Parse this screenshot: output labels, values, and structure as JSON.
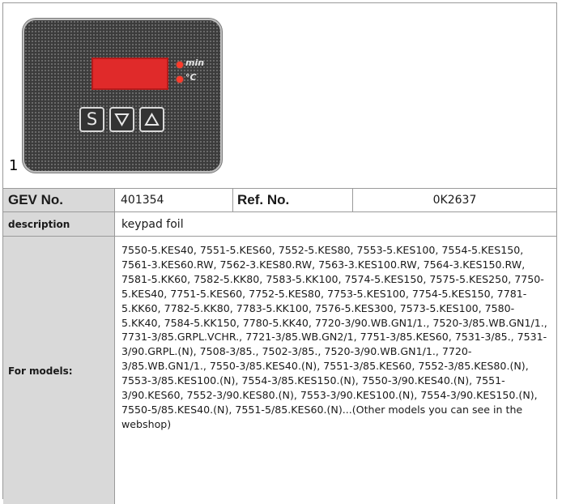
{
  "figure": {
    "number": "1",
    "led_labels": [
      "min",
      "°C"
    ],
    "buttons": [
      {
        "symbol": "S",
        "name": "set"
      },
      {
        "symbol": "▽",
        "name": "down"
      },
      {
        "symbol": "△",
        "name": "up"
      }
    ]
  },
  "product": {
    "gev_label": "GEV No.",
    "gev_value": "401354",
    "ref_label": "Ref. No.",
    "ref_value": "0K2637",
    "description_label": "description",
    "description_value": "keypad foil",
    "models_label": "For models:",
    "models_value": "7550-5.KES40, 7551-5.KES60, 7552-5.KES80, 7553-5.KES100, 7554-5.KES150, 7561-3.KES60.RW, 7562-3.KES80.RW, 7563-3.KES100.RW, 7564-3.KES150.RW, 7581-5.KK60, 7582-5.KK80, 7583-5.KK100, 7574-5.KES150, 7575-5.KES250, 7750-5.KES40, 7751-5.KES60, 7752-5.KES80, 7753-5.KES100, 7754-5.KES150, 7781-5.KK60, 7782-5.KK80, 7783-5.KK100, 7576-5.KES300, 7573-5.KES100, 7580-5.KK40, 7584-5.KK150, 7780-5.KK40, 7720-3/90.WB.GN1/1., 7520-3/85.WB.GN1/1., 7731-3/85.GRPL.VCHR., 7721-3/85.WB.GN2/1, 7751-3/85.KES60, 7531-3/85., 7531-3/90.GRPL.(N), 7508-3/85., 7502-3/85., 7520-3/90.WB.GN1/1., 7720-3/85.WB.GN1/1., 7550-3/85.KES40.(N), 7551-3/85.KES60, 7552-3/85.KES80.(N), 7553-3/85.KES100.(N), 7554-3/85.KES150.(N), 7550-3/90.KES40.(N), 7551-3/90.KES60, 7552-3/90.KES80.(N), 7553-3/90.KES100.(N), 7554-3/90.KES150.(N), 7550-5/85.KES40.(N), 7551-5/85.KES60.(N)...(Other models you can see in the webshop)"
  },
  "colors": {
    "label_bg": "#d9d9d9",
    "border": "#9a9a9a",
    "display_red": "#e02a2a",
    "panel_dark": "#3b3b3b"
  }
}
